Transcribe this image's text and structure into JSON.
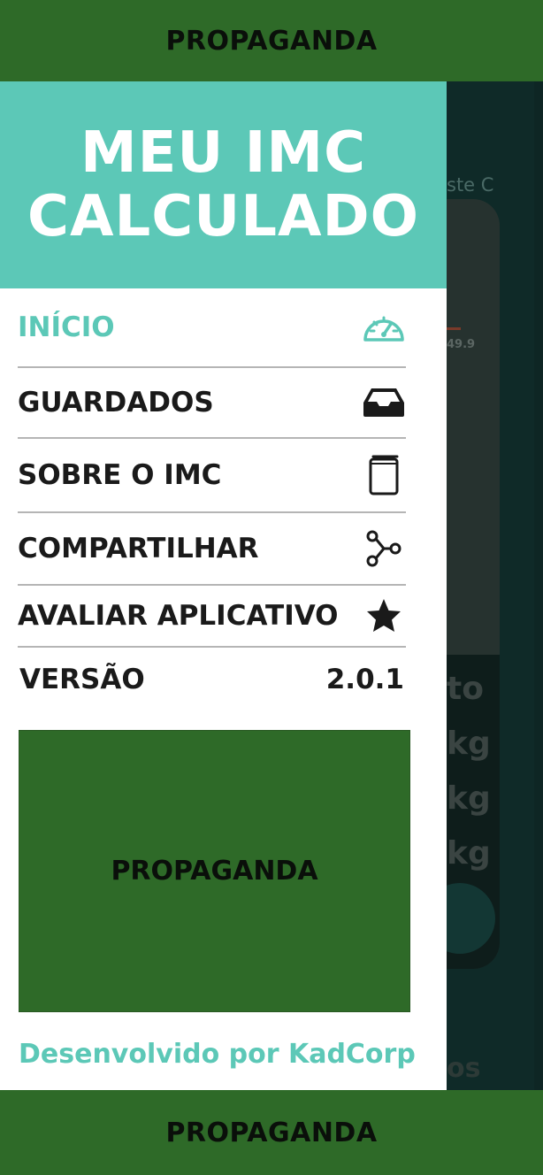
{
  "ads": {
    "top_label": "PROPAGANDA",
    "drawer_label": "PROPAGANDA",
    "bottom_label": "PROPAGANDA"
  },
  "drawer": {
    "title_line1": "MEU IMC",
    "title_line2": "CALCULADO",
    "menu": [
      {
        "label": "INÍCIO",
        "icon": "speedometer-icon",
        "active": true
      },
      {
        "label": "GUARDADOS",
        "icon": "inbox-icon",
        "active": false
      },
      {
        "label": "SOBRE O IMC",
        "icon": "book-icon",
        "active": false
      },
      {
        "label": "COMPARTILHAR",
        "icon": "share-icon",
        "active": false
      },
      {
        "label": "AVALIAR APLICATIVO",
        "icon": "star-icon",
        "active": false
      }
    ],
    "version_label": "VERSÃO",
    "version_value": "2.0.1",
    "developer": "Desenvolvido por KadCorp"
  },
  "background": {
    "teste": "ste C",
    "value": "49.9",
    "row1": "to",
    "row2": "kg",
    "row3": "kg",
    "row4": "kg",
    "row5": "os"
  },
  "colors": {
    "accent": "#5cc8b7",
    "ad_green": "#2e6a28",
    "text_dark": "#1a1a1a"
  }
}
